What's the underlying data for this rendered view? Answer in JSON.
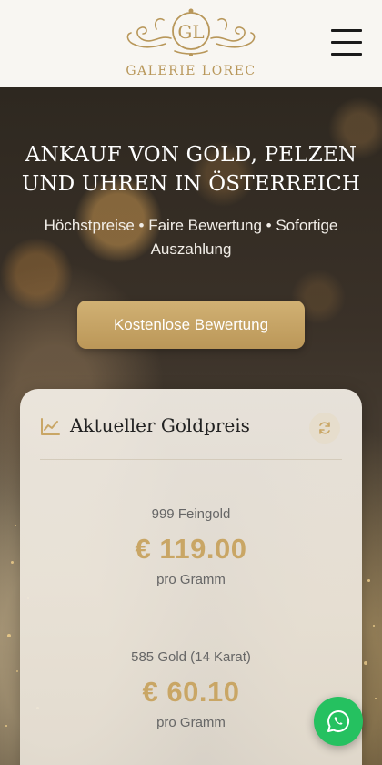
{
  "header": {
    "logo_text": "GALERIE LOREC",
    "logo_monogram": "GL",
    "menu_icon": "hamburger-menu-icon"
  },
  "hero": {
    "title_line1": "ANKAUF VON GOLD, PELZEN",
    "title_line2": "UND UHREN IN ÖSTERREICH",
    "subtitle": "Höchstpreise • Faire Bewertung • Sofortige Auszahlung",
    "cta_label": "Kostenlose Bewertung"
  },
  "gold_card": {
    "icon": "chart-line-icon",
    "title": "Aktueller Goldpreis",
    "refresh_icon": "refresh-icon",
    "prices": [
      {
        "label": "999 Feingold",
        "value": "€ 119.00",
        "unit": "pro Gramm"
      },
      {
        "label": "585 Gold (14 Karat)",
        "value": "€ 60.10",
        "unit": "pro Gramm"
      }
    ]
  },
  "whatsapp": {
    "icon": "whatsapp-icon"
  },
  "colors": {
    "gold_accent": "#c9a665",
    "button_gold": "#c4a263",
    "whatsapp_green": "#25c160",
    "header_bg": "#f8f6f2"
  }
}
